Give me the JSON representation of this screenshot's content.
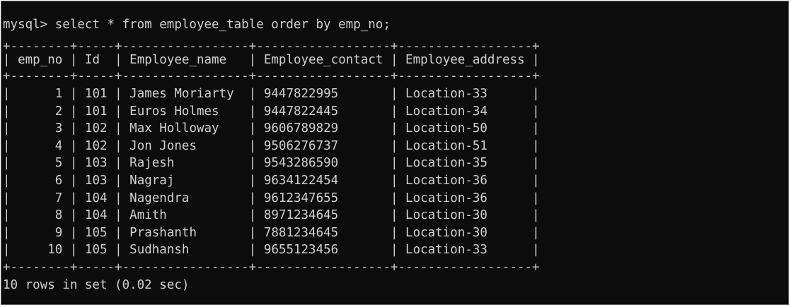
{
  "terminal": {
    "prompt": "mysql>",
    "command": "select * from employee_table order by emp_no;",
    "border_line": "+--------+-----+-----------------+------------------+------------------+",
    "columns": [
      "emp_no",
      "Id",
      "Employee_name",
      "Employee_contact",
      "Employee_address"
    ],
    "rows": [
      {
        "emp_no": "1",
        "id": "101",
        "name": "James Moriarty",
        "contact": "9447822995",
        "address": "Location-33"
      },
      {
        "emp_no": "2",
        "id": "101",
        "name": "Euros Holmes",
        "contact": "9447822445",
        "address": "Location-34"
      },
      {
        "emp_no": "3",
        "id": "102",
        "name": "Max Holloway",
        "contact": "9606789829",
        "address": "Location-50"
      },
      {
        "emp_no": "4",
        "id": "102",
        "name": "Jon Jones",
        "contact": "9506276737",
        "address": "Location-51"
      },
      {
        "emp_no": "5",
        "id": "103",
        "name": "Rajesh",
        "contact": "9543286590",
        "address": "Location-35"
      },
      {
        "emp_no": "6",
        "id": "103",
        "name": "Nagraj",
        "contact": "9634122454",
        "address": "Location-36"
      },
      {
        "emp_no": "7",
        "id": "104",
        "name": "Nagendra",
        "contact": "9612347655",
        "address": "Location-36"
      },
      {
        "emp_no": "8",
        "id": "104",
        "name": "Amith",
        "contact": "8971234645",
        "address": "Location-30"
      },
      {
        "emp_no": "9",
        "id": "105",
        "name": "Prashanth",
        "contact": "7881234645",
        "address": "Location-30"
      },
      {
        "emp_no": "10",
        "id": "105",
        "name": "Sudhansh",
        "contact": "9655123456",
        "address": "Location-33"
      }
    ],
    "result_summary": "10 rows in set (0.02 sec)"
  },
  "colors": {
    "background": "#0c0c0c",
    "text": "#d0d0d0"
  }
}
